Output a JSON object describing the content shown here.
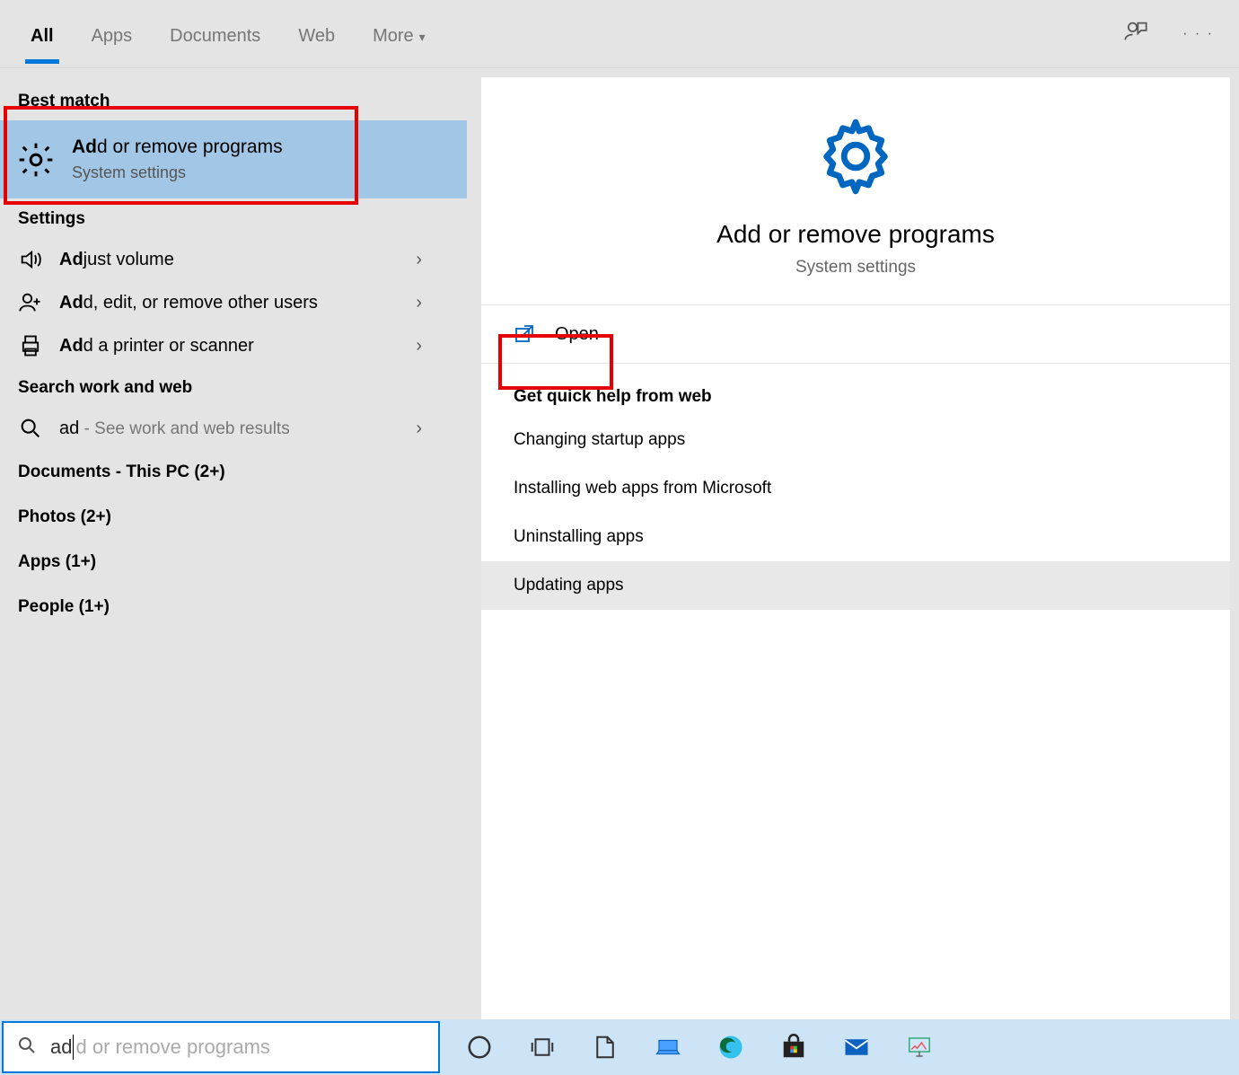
{
  "tabs": {
    "all": "All",
    "apps": "Apps",
    "documents": "Documents",
    "web": "Web",
    "more": "More"
  },
  "left": {
    "best_match_label": "Best match",
    "best_match": {
      "title_bold": "Ad",
      "title_rest": "d or remove programs",
      "subtitle": "System settings"
    },
    "settings_label": "Settings",
    "settings_items": [
      {
        "bold": "Ad",
        "rest": "just volume"
      },
      {
        "bold": "Ad",
        "rest": "d, edit, or remove other users"
      },
      {
        "bold": "Ad",
        "rest": "d a printer or scanner"
      }
    ],
    "search_work_web_label": "Search work and web",
    "search_web": {
      "query": "ad",
      "hint_sep": " - ",
      "hint": "See work and web results"
    },
    "extra_groups": [
      "Documents - This PC (2+)",
      "Photos (2+)",
      "Apps (1+)",
      "People (1+)"
    ]
  },
  "right": {
    "title": "Add or remove programs",
    "subtitle": "System settings",
    "open_label": "Open",
    "quick_head": "Get quick help from web",
    "quick_items": [
      "Changing startup apps",
      "Installing web apps from Microsoft",
      "Uninstalling apps",
      "Updating apps"
    ]
  },
  "search": {
    "typed": "ad",
    "placeholder_rest": "d or remove programs"
  }
}
